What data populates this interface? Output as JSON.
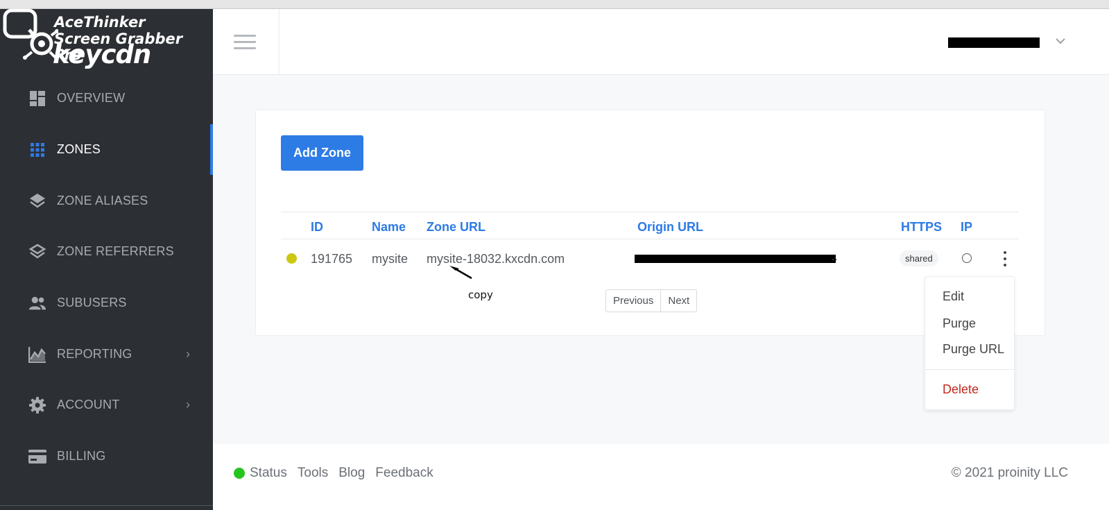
{
  "watermark": {
    "line1": "AceThinker",
    "line2": "Screen Grabber Pro"
  },
  "brand": {
    "name": "keycdn"
  },
  "sidebar": {
    "items": [
      {
        "label": "OVERVIEW",
        "icon": "dashboard-icon"
      },
      {
        "label": "ZONES",
        "icon": "grid-icon",
        "active": true
      },
      {
        "label": "ZONE ALIASES",
        "icon": "layers-icon"
      },
      {
        "label": "ZONE REFERRERS",
        "icon": "layers-outline-icon"
      },
      {
        "label": "SUBUSERS",
        "icon": "people-icon"
      },
      {
        "label": "REPORTING",
        "icon": "chart-icon",
        "has_submenu": true
      },
      {
        "label": "ACCOUNT",
        "icon": "gear-icon",
        "has_submenu": true
      },
      {
        "label": "BILLING",
        "icon": "credit-card-icon"
      }
    ]
  },
  "main": {
    "add_zone_label": "Add Zone",
    "table": {
      "headers": {
        "id": "ID",
        "name": "Name",
        "zone_url": "Zone URL",
        "origin_url": "Origin URL",
        "https": "HTTPS",
        "ip": "IP"
      },
      "rows": [
        {
          "id": "191765",
          "name": "mysite",
          "zone_url": "mysite-18032.kxcdn.com",
          "origin_suffix": "..",
          "https": "shared",
          "status_color": "#ccc80f"
        }
      ]
    },
    "annotation": "copy",
    "pagination": {
      "previous": "Previous",
      "next": "Next"
    },
    "dropdown": {
      "edit": "Edit",
      "purge": "Purge",
      "purge_url": "Purge URL",
      "delete": "Delete"
    }
  },
  "footer": {
    "links": [
      "Status",
      "Tools",
      "Blog",
      "Feedback"
    ],
    "copyright": "© 2021 proinity LLC"
  },
  "colors": {
    "accent": "#2d7be5",
    "sidebar_bg": "#2c2f33",
    "delete": "#c0291f",
    "status_green": "#25c41e"
  }
}
